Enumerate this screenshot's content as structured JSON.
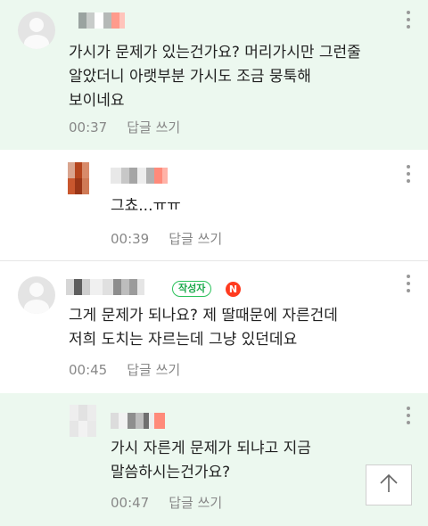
{
  "comments": [
    {
      "text": "가시가 문제가 있는건가요? 머리가시만 그런줄\n알았더니 아랫부분 가시도 조금 뭉툭해\n보이네요",
      "time": "00:37",
      "reply_label": "답글 쓰기"
    },
    {
      "text": "그쵸...ㅠㅠ",
      "time": "00:39",
      "reply_label": "답글 쓰기"
    },
    {
      "text": "그게 문제가 되나요? 제 딸때문에 자른건데\n저희 도치는 자르는데 그냥 있던데요",
      "time": "00:45",
      "reply_label": "답글 쓰기",
      "author_badge": "작성자",
      "new_badge": "N"
    },
    {
      "text": "가시 자른게 문제가 되냐고 지금\n말씀하시는건가요?",
      "time": "00:47",
      "reply_label": "답글 쓰기"
    }
  ],
  "icons": {
    "more": "more-vertical-icon",
    "avatar": "default-profile-icon",
    "scroll_top": "arrow-up-icon"
  },
  "colors": {
    "highlight_bg": "#ecf8ef",
    "author_badge": "#2bc25b",
    "new_badge": "#ff3b1f",
    "meta_text": "#888888"
  }
}
